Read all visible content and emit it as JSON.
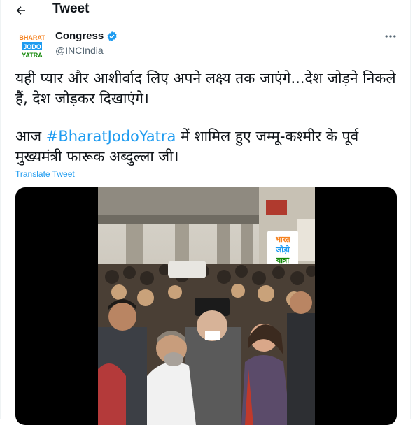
{
  "header": {
    "back_icon": "arrow-left-icon",
    "title": "Tweet"
  },
  "author": {
    "name": "Congress",
    "handle": "@INCIndia",
    "verified": true,
    "avatar_lines": [
      "BHARAT",
      "JODO",
      "YATRA"
    ]
  },
  "more_icon": "more-horizontal-icon",
  "tweet": {
    "para1": "यही प्यार और आशीर्वाद लिए अपने लक्ष्य तक जाएंगे...देश जोड़ने निकले हैं, देश जोड़कर दिखाएंगे।",
    "para2_prefix": "आज ",
    "hashtag": "#BharatJodoYatra",
    "para2_suffix": " में शामिल हुए जम्मू-कश्मीर के पूर्व मुख्यमंत्री फारूक अब्दुल्ला जी।"
  },
  "translate_label": "Translate Tweet",
  "photo": {
    "sign_lines": [
      "भारत",
      "जोड़ो",
      "यात्रा"
    ]
  },
  "colors": {
    "link": "#1d9bf0",
    "secondary_text": "#536471",
    "accent_orange": "#f58220",
    "accent_green": "#138808"
  }
}
